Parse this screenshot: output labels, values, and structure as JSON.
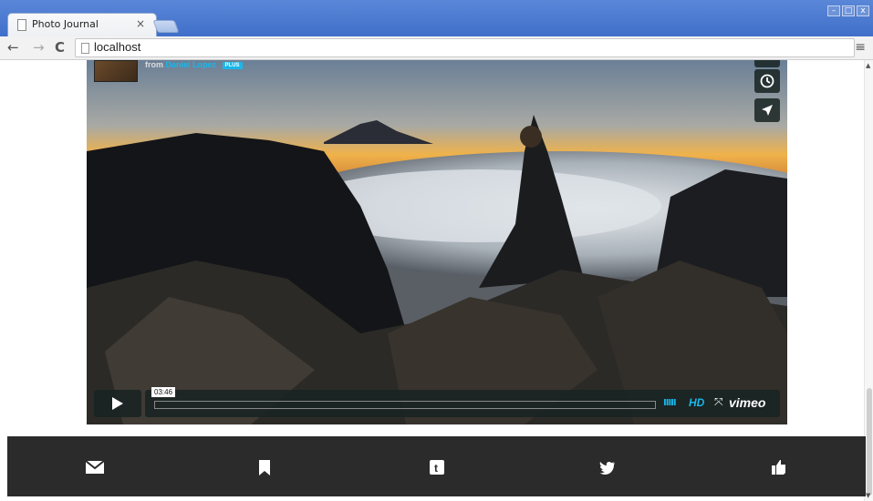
{
  "browser": {
    "tab_title": "Photo Journal",
    "tab_close": "×",
    "url": "localhost",
    "window_controls": [
      "–",
      "□",
      "x"
    ]
  },
  "video": {
    "from_label": "from",
    "author": "Daniel Lopez",
    "badge": "PLUS",
    "timecode": "03:46",
    "hd_label": "HD",
    "brand": "vimeo",
    "volume_glyph": "IIIII",
    "progress": 0
  },
  "share": {
    "icons": [
      "mail-icon",
      "bookmark-icon",
      "tumblr-icon",
      "twitter-icon",
      "thumbs-up-icon"
    ]
  },
  "colors": {
    "accent": "#19b7ea",
    "share_bar": "#2b2b2b",
    "control_bg": "#172322"
  }
}
